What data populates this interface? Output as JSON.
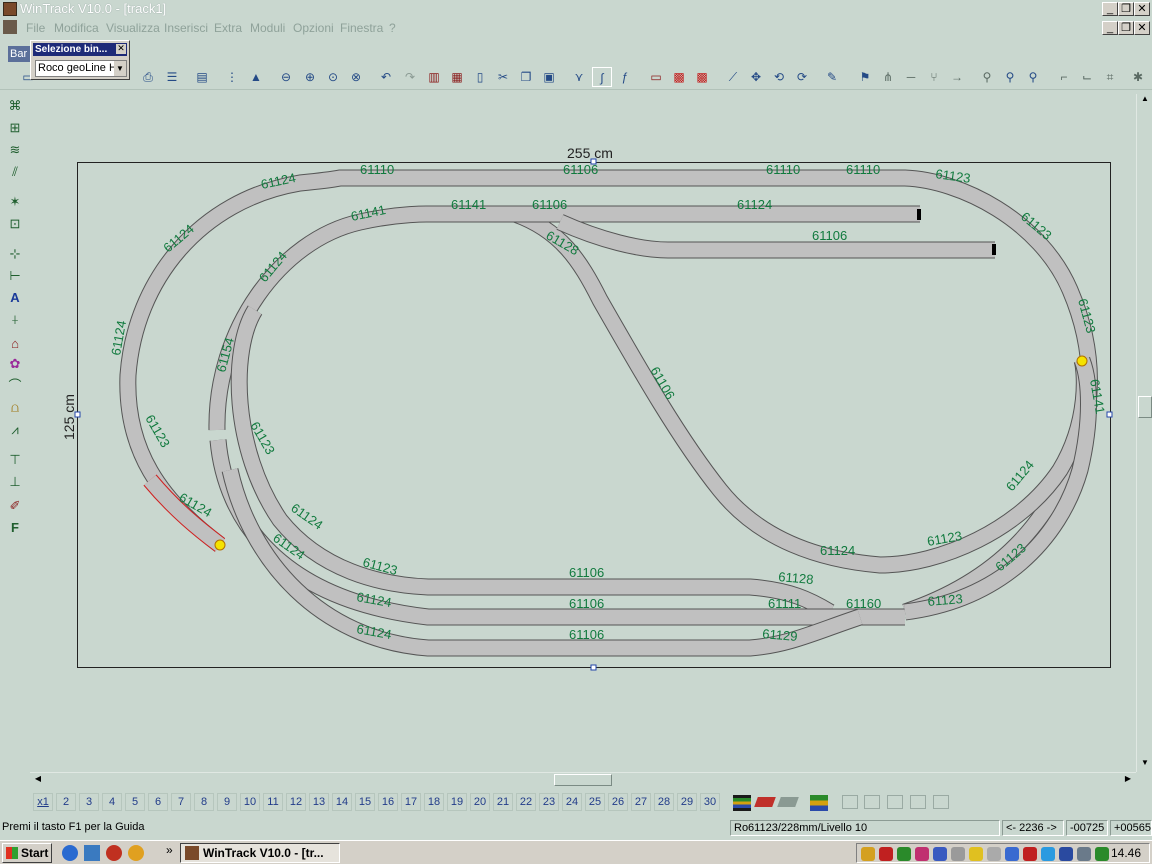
{
  "window": {
    "title": "WinTrack  V10.0 - [track1]",
    "controls": [
      "_",
      "❐",
      "✕"
    ]
  },
  "menu": {
    "items": [
      "File",
      "Modifica",
      "Visualizza",
      "Inserisci",
      "Extra",
      "Moduli",
      "Opzioni",
      "Finestra",
      "?"
    ]
  },
  "panel": {
    "title": "Selezione bin...",
    "select_value": "Roco geoLine H",
    "tab_label": "Bar"
  },
  "layout": {
    "width_label": "255 cm",
    "height_label": "125 cm",
    "track_labels": [
      "61124",
      "61110",
      "61106",
      "61110",
      "61110",
      "61123",
      "61124",
      "61141",
      "61141",
      "61106",
      "61124",
      "61128",
      "61106",
      "61123",
      "61124",
      "61124",
      "61123",
      "61154",
      "61106",
      "61123",
      "61123",
      "61124",
      "61124",
      "61124",
      "61123",
      "61106",
      "61128",
      "61106",
      "61111",
      "61160",
      "61123",
      "61124",
      "61106",
      "61129",
      "61124",
      "61124",
      "61123",
      "61123",
      "61141",
      "61124"
    ],
    "track_color": "#c0c0c0",
    "label_color": "#117a3e"
  },
  "pages": [
    "x1",
    "2",
    "3",
    "4",
    "5",
    "6",
    "7",
    "8",
    "9",
    "10",
    "11",
    "12",
    "13",
    "14",
    "15",
    "16",
    "17",
    "18",
    "19",
    "20",
    "21",
    "22",
    "23",
    "24",
    "25",
    "26",
    "27",
    "28",
    "29",
    "30"
  ],
  "status": {
    "help": "Premi il tasto F1 per la Guida",
    "info": "Ro61123/228mm/Livello 10",
    "coord1": "<- 2236 ->",
    "coord2": "-00725",
    "coord3": "+00565"
  },
  "taskbar": {
    "start": "Start",
    "task": "WinTrack  V10.0 - [tr...",
    "clock": "14.46"
  }
}
